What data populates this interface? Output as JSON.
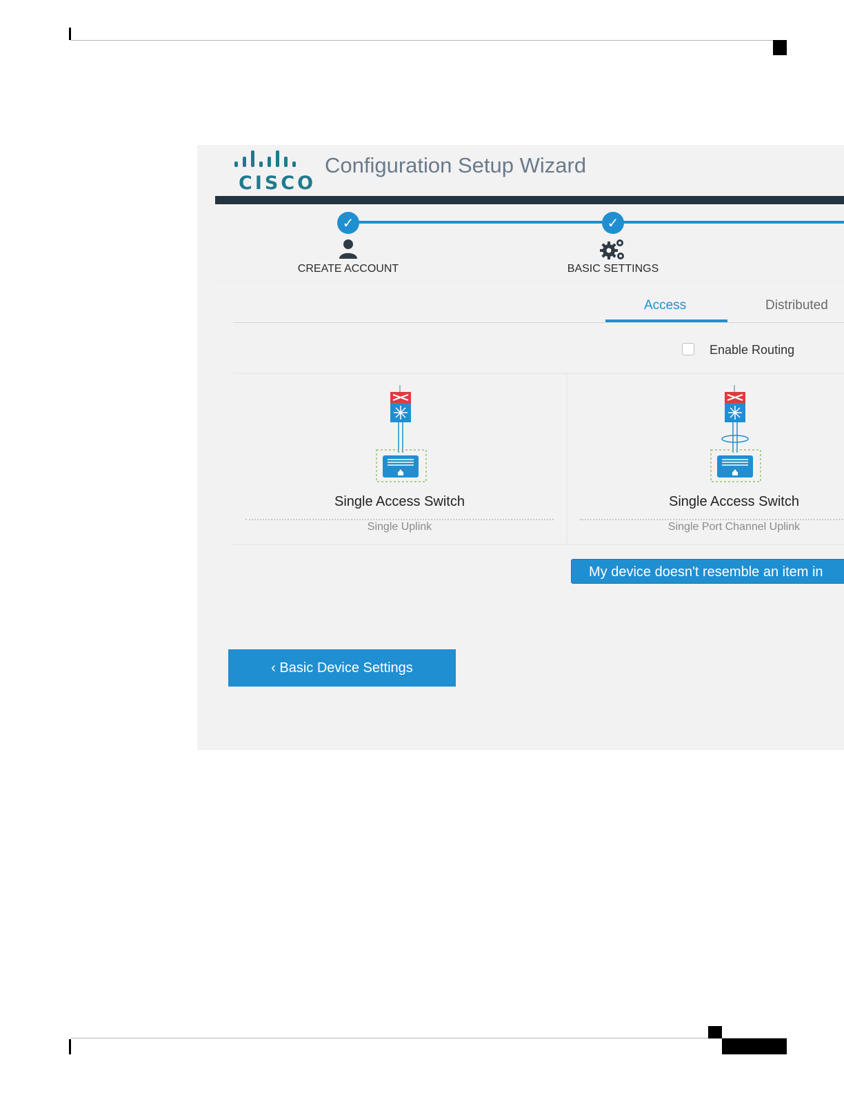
{
  "wizard": {
    "logo_text": "CISCO",
    "title": "Configuration Setup Wizard"
  },
  "stepper": {
    "steps": [
      {
        "label": "CREATE ACCOUNT",
        "check": "✓",
        "icon": "user-icon"
      },
      {
        "label": "BASIC SETTINGS",
        "check": "✓",
        "icon": "gears-icon"
      }
    ]
  },
  "tabs": [
    {
      "label": "Access",
      "active": true
    },
    {
      "label": "Distributed",
      "active": false
    }
  ],
  "routing": {
    "label": "Enable Routing",
    "checked": false
  },
  "options": [
    {
      "title": "Single Access Switch",
      "subtitle": "Single Uplink",
      "icon": "single-uplink-topology-icon"
    },
    {
      "title": "Single Access Switch",
      "subtitle": "Single Port Channel Uplink",
      "icon": "port-channel-uplink-topology-icon"
    }
  ],
  "buttons": {
    "resemble": "My device doesn't resemble an item in",
    "back": "‹ Basic Device Settings"
  },
  "colors": {
    "accent": "#1f8fd1",
    "header_bar": "#243340",
    "logo": "#1f7a8c",
    "switch_red": "#e03a3e"
  }
}
